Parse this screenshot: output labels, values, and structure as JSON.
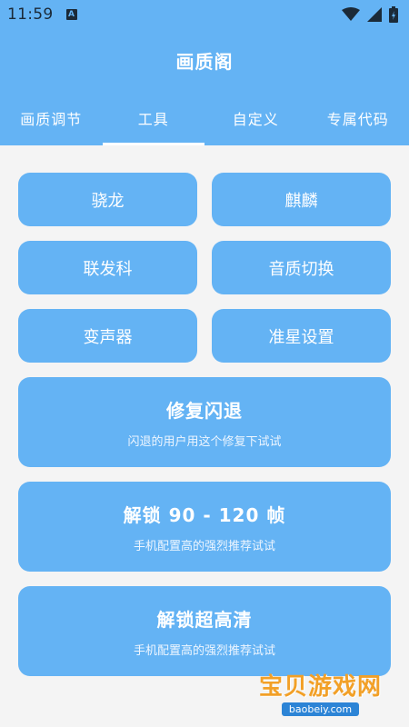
{
  "status": {
    "time": "11:59",
    "notif": "A"
  },
  "app": {
    "title": "画质阁"
  },
  "tabs": [
    {
      "label": "画质调节"
    },
    {
      "label": "工具"
    },
    {
      "label": "自定义"
    },
    {
      "label": "专属代码"
    }
  ],
  "tools": [
    {
      "label": "骁龙"
    },
    {
      "label": "麒麟"
    },
    {
      "label": "联发科"
    },
    {
      "label": "音质切换"
    },
    {
      "label": "变声器"
    },
    {
      "label": "准星设置"
    }
  ],
  "actions": [
    {
      "title": "修复闪退",
      "subtitle": "闪退的用户用这个修复下试试"
    },
    {
      "title": "解锁 90 - 120 帧",
      "subtitle": "手机配置高的强烈推荐试试"
    },
    {
      "title": "解锁超高清",
      "subtitle": "手机配置高的强烈推荐试试"
    }
  ],
  "watermark": {
    "text": "宝贝游戏网",
    "url": "baobeiy.com"
  },
  "colors": {
    "primary": "#64b3f4",
    "background": "#f4f4f4",
    "text_on_primary": "#ffffff"
  }
}
